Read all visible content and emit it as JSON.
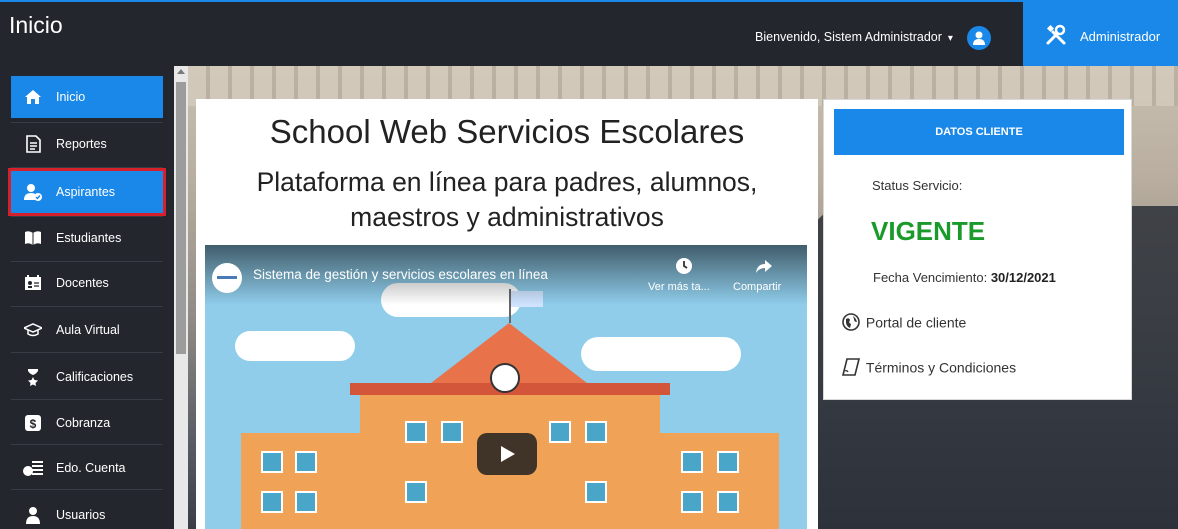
{
  "header": {
    "title": "Inicio",
    "welcome": "Bienvenido, Sistem Administrador",
    "admin_label": "Administrador"
  },
  "sidebar": {
    "items": [
      {
        "label": "Inicio",
        "icon": "home-icon",
        "state": "active"
      },
      {
        "label": "Reportes",
        "icon": "document-icon"
      },
      {
        "label": "Aspirantes",
        "icon": "user-check-icon",
        "state": "selected"
      },
      {
        "label": "Estudiantes",
        "icon": "book-icon"
      },
      {
        "label": "Docentes",
        "icon": "teacher-icon"
      },
      {
        "label": "Aula Virtual",
        "icon": "graduation-cap-icon"
      },
      {
        "label": "Calificaciones",
        "icon": "award-icon"
      },
      {
        "label": "Cobranza",
        "icon": "dollar-icon"
      },
      {
        "label": "Edo. Cuenta",
        "icon": "coins-icon"
      },
      {
        "label": "Usuarios",
        "icon": "user-icon"
      }
    ]
  },
  "main": {
    "title": "School Web Servicios Escolares",
    "subtitle_line1": "Plataforma en línea para padres, alumnos,",
    "subtitle_line2": "maestros y administrativos",
    "video": {
      "title": "Sistema de gestión y servicios escolares en línea",
      "watch_later": "Ver más ta...",
      "share": "Compartir"
    }
  },
  "client": {
    "button": "DATOS CLIENTE",
    "status_label": "Status Servicio:",
    "status_value": "VIGENTE",
    "expiry_label": "Fecha Vencimiento:",
    "expiry_value": "30/12/2021",
    "portal_link": "Portal de cliente",
    "terms_link": "Términos y Condiciones"
  },
  "colors": {
    "accent": "#1a88e8",
    "sidebar_bg": "#23262d",
    "status_ok": "#1a9a2a",
    "highlight_border": "#d6202c"
  }
}
